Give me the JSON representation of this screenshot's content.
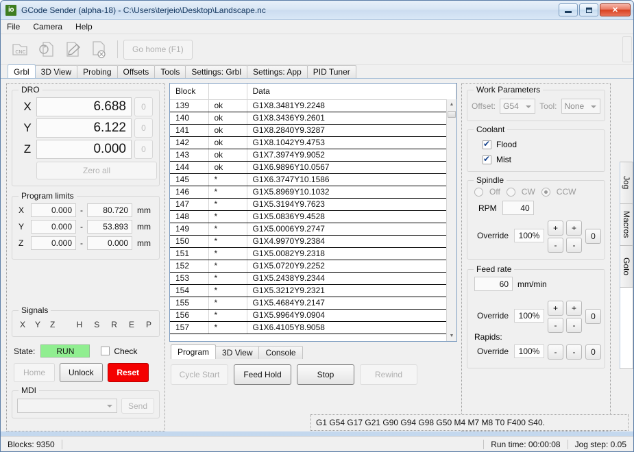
{
  "window": {
    "app_icon": "io",
    "title": "GCode Sender (alpha-18) - C:\\Users\\terjeio\\Desktop\\Landscape.nc",
    "minimize": "—",
    "maximize": "□",
    "close": "✕"
  },
  "menu": {
    "items": [
      "File",
      "Camera",
      "Help"
    ]
  },
  "toolbar": {
    "icons": [
      "open-cnc-file-icon",
      "reload-file-icon",
      "edit-file-icon",
      "close-file-icon"
    ],
    "cnc_label": "CNC",
    "go_home_label": "Go home (F1)"
  },
  "main_tabs": {
    "items": [
      "Grbl",
      "3D View",
      "Probing",
      "Offsets",
      "Tools",
      "Settings: Grbl",
      "Settings: App",
      "PID Tuner"
    ],
    "active": "Grbl"
  },
  "dro": {
    "title": "DRO",
    "axes": [
      {
        "name": "X",
        "value": "6.688",
        "zero": "0"
      },
      {
        "name": "Y",
        "value": "6.122",
        "zero": "0"
      },
      {
        "name": "Z",
        "value": "0.000",
        "zero": "0"
      }
    ],
    "zero_all": "Zero all"
  },
  "program_limits": {
    "title": "Program limits",
    "unit": "mm",
    "separator": "-",
    "rows": [
      {
        "axis": "X",
        "min": "0.000",
        "max": "80.720"
      },
      {
        "axis": "Y",
        "min": "0.000",
        "max": "53.893"
      },
      {
        "axis": "Z",
        "min": "0.000",
        "max": "0.000"
      }
    ]
  },
  "signals": {
    "title": "Signals",
    "left": [
      "X",
      "Y",
      "Z"
    ],
    "right": [
      "H",
      "S",
      "R",
      "E",
      "P"
    ]
  },
  "state": {
    "label": "State:",
    "value": "RUN",
    "color": "#90ee90",
    "check_label": "Check",
    "check_checked": false
  },
  "actions": {
    "home": "Home",
    "unlock": "Unlock",
    "reset": "Reset",
    "reset_color": "#f40000"
  },
  "mdi": {
    "title": "MDI",
    "input_value": "",
    "placeholder": "",
    "send": "Send"
  },
  "program_table": {
    "columns": [
      "Block",
      "",
      "Data"
    ],
    "rows": [
      {
        "block": "139",
        "status": "ok",
        "data": "G1X8.3481Y9.2248"
      },
      {
        "block": "140",
        "status": "ok",
        "data": "G1X8.3436Y9.2601"
      },
      {
        "block": "141",
        "status": "ok",
        "data": "G1X8.2840Y9.3287"
      },
      {
        "block": "142",
        "status": "ok",
        "data": "G1X8.1042Y9.4753"
      },
      {
        "block": "143",
        "status": "ok",
        "data": "G1X7.3974Y9.9052"
      },
      {
        "block": "144",
        "status": "ok",
        "data": "G1X6.9896Y10.0567"
      },
      {
        "block": "145",
        "status": "*",
        "data": "G1X6.3747Y10.1586"
      },
      {
        "block": "146",
        "status": "*",
        "data": "G1X5.8969Y10.1032"
      },
      {
        "block": "147",
        "status": "*",
        "data": "G1X5.3194Y9.7623"
      },
      {
        "block": "148",
        "status": "*",
        "data": "G1X5.0836Y9.4528"
      },
      {
        "block": "149",
        "status": "*",
        "data": "G1X5.0006Y9.2747"
      },
      {
        "block": "150",
        "status": "*",
        "data": "G1X4.9970Y9.2384"
      },
      {
        "block": "151",
        "status": "*",
        "data": "G1X5.0082Y9.2318"
      },
      {
        "block": "152",
        "status": "*",
        "data": "G1X5.0720Y9.2252"
      },
      {
        "block": "153",
        "status": "*",
        "data": "G1X5.2438Y9.2344"
      },
      {
        "block": "154",
        "status": "*",
        "data": "G1X5.3212Y9.2321"
      },
      {
        "block": "155",
        "status": "*",
        "data": "G1X5.4684Y9.2147"
      },
      {
        "block": "156",
        "status": "*",
        "data": "G1X5.9964Y9.0904"
      },
      {
        "block": "157",
        "status": "*",
        "data": "G1X6.4105Y8.9058"
      }
    ]
  },
  "sub_tabs": {
    "items": [
      "Program",
      "3D View",
      "Console"
    ],
    "active": "Program"
  },
  "run_controls": {
    "cycle_start": "Cycle Start",
    "feed_hold": "Feed Hold",
    "stop": "Stop",
    "rewind": "Rewind"
  },
  "work_parameters": {
    "title": "Work Parameters",
    "offset_label": "Offset:",
    "offset_value": "G54",
    "tool_label": "Tool:",
    "tool_value": "None"
  },
  "coolant": {
    "title": "Coolant",
    "items": [
      {
        "label": "Flood",
        "checked": true
      },
      {
        "label": "Mist",
        "checked": true
      }
    ]
  },
  "spindle": {
    "title": "Spindle",
    "modes": [
      {
        "label": "Off",
        "selected": false
      },
      {
        "label": "CW",
        "selected": false
      },
      {
        "label": "CCW",
        "selected": true
      }
    ],
    "rpm_label": "RPM",
    "rpm_value": "40",
    "override_label": "Override",
    "override_value": "100%",
    "plus": "+",
    "minus": "-",
    "reset": "0"
  },
  "feed_rate": {
    "title": "Feed rate",
    "value": "60",
    "unit": "mm/min",
    "override_label": "Override",
    "override_value": "100%",
    "rapids_label": "Rapids:",
    "rapids_override_label": "Override",
    "rapids_override_value": "100%",
    "plus": "+",
    "minus": "-",
    "reset": "0"
  },
  "vertical_tabs": {
    "items": [
      "Jog",
      "Macros",
      "Goto"
    ]
  },
  "gcode_state_line": "G1 G54 G17 G21 G90 G94 G98 G50 M4 M7 M8 T0 F400 S40.",
  "status_bar": {
    "blocks": "Blocks: 9350",
    "run_time": "Run time: 00:00:08",
    "jog_step": "Jog step: 0.05"
  }
}
